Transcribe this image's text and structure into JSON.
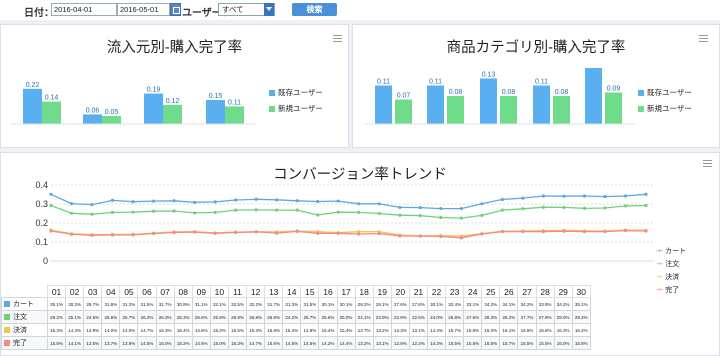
{
  "toolbar": {
    "date_label": "日付：",
    "date_from": "2016-04-01",
    "date_to": "2016-05-01",
    "user_label": "ユーザー：",
    "user_select_value": "すべて",
    "search_label": "検索"
  },
  "panel1": {
    "title": "流入元別-購入完了率",
    "legend": [
      "既存ユーザー",
      "新規ユーザー"
    ]
  },
  "panel2": {
    "title": "商品カテゴリ別-購入完了率",
    "legend": [
      "既存ユーザー",
      "新規ユーザー"
    ]
  },
  "panel3": {
    "title": "コンバージョン率トレンド",
    "legend": [
      "カート",
      "注文",
      "決済",
      "完了"
    ]
  },
  "colors": {
    "existing": "#5aaff0",
    "new": "#6fdc8c",
    "cart": "#5ba8e6",
    "order": "#6fd27a",
    "payment": "#f6c155",
    "complete": "#f28a86"
  },
  "chart_data": [
    {
      "type": "bar",
      "title": "流入元別-購入完了率",
      "categories": [
        "",
        "",
        "",
        ""
      ],
      "series": [
        {
          "name": "既存ユーザー",
          "values": [
            0.22,
            0.06,
            0.19,
            0.15
          ]
        },
        {
          "name": "新規ユーザー",
          "values": [
            0.14,
            0.05,
            0.12,
            0.11
          ]
        }
      ],
      "value_labels": [
        [
          "0.22",
          "0.06",
          "0.19",
          "0.15"
        ],
        [
          "0.14",
          "0.05",
          "0.12",
          "0.11"
        ]
      ],
      "legend_position": "right"
    },
    {
      "type": "bar",
      "title": "商品カテゴリ別-購入完了率",
      "categories": [
        "",
        "",
        "",
        "",
        ""
      ],
      "series": [
        {
          "name": "既存ユーザー",
          "values": [
            0.11,
            0.11,
            0.13,
            0.11,
            0.16
          ]
        },
        {
          "name": "新規ユーザー",
          "values": [
            0.07,
            0.08,
            0.08,
            0.08,
            0.09
          ]
        }
      ],
      "value_labels": [
        [
          "0.11",
          "0.11",
          "0.13",
          "0.11",
          ""
        ],
        [
          "0.07",
          "0.08",
          "0.08",
          "0.08",
          "0.09"
        ]
      ],
      "legend_position": "right"
    },
    {
      "type": "line",
      "title": "コンバージョン率トレンド",
      "x": [
        "01",
        "02",
        "03",
        "04",
        "05",
        "06",
        "07",
        "08",
        "09",
        "10",
        "11",
        "12",
        "13",
        "14",
        "15",
        "16",
        "17",
        "18",
        "19",
        "20",
        "21",
        "22",
        "23",
        "24",
        "25",
        "26",
        "27",
        "28",
        "29",
        "30"
      ],
      "yticks": [
        "0.4",
        "0.3",
        "0.2",
        "0.1",
        "0"
      ],
      "ylim": [
        0,
        0.4
      ],
      "grid": true,
      "legend_position": "right",
      "series": [
        {
          "name": "カート",
          "values": [
            0.351,
            0.302,
            0.297,
            0.319,
            0.312,
            0.315,
            0.317,
            0.309,
            0.311,
            0.321,
            0.325,
            0.322,
            0.317,
            0.313,
            0.315,
            0.301,
            0.301,
            0.282,
            0.281,
            0.276,
            0.276,
            0.301,
            0.324,
            0.331,
            0.342,
            0.341,
            0.342,
            0.339,
            0.342,
            0.351
          ],
          "labels": [
            "35.1%",
            "30.2%",
            "29.7%",
            "31.9%",
            "31.2%",
            "31.5%",
            "31.7%",
            "30.9%",
            "31.1%",
            "32.1%",
            "32.5%",
            "32.2%",
            "31.7%",
            "31.3%",
            "31.5%",
            "30.1%",
            "30.1%",
            "28.2%",
            "28.1%",
            "27.6%",
            "27.6%",
            "30.1%",
            "32.4%",
            "33.1%",
            "34.2%",
            "34.1%",
            "34.2%",
            "33.9%",
            "34.2%",
            "35.1%"
          ]
        },
        {
          "name": "注文",
          "values": [
            0.292,
            0.251,
            0.246,
            0.256,
            0.257,
            0.262,
            0.263,
            0.253,
            0.256,
            0.268,
            0.269,
            0.268,
            0.268,
            0.242,
            0.257,
            0.256,
            0.25,
            0.241,
            0.239,
            0.229,
            0.226,
            0.24,
            0.268,
            0.275,
            0.283,
            0.282,
            0.277,
            0.279,
            0.29,
            0.292
          ],
          "labels": [
            "29.2%",
            "25.1%",
            "24.6%",
            "25.6%",
            "25.7%",
            "26.2%",
            "26.3%",
            "25.3%",
            "25.6%",
            "26.8%",
            "26.9%",
            "26.8%",
            "26.8%",
            "24.2%",
            "25.7%",
            "25.6%",
            "25.0%",
            "24.1%",
            "23.9%",
            "22.9%",
            "22.6%",
            "24.0%",
            "26.8%",
            "27.5%",
            "28.3%",
            "28.2%",
            "27.7%",
            "27.9%",
            "29.0%",
            "29.2%"
          ]
        },
        {
          "name": "決済",
          "values": [
            0.163,
            0.143,
            0.139,
            0.14,
            0.14,
            0.147,
            0.153,
            0.154,
            0.148,
            0.152,
            0.155,
            0.153,
            0.158,
            0.154,
            0.149,
            0.154,
            0.154,
            0.137,
            0.132,
            0.133,
            0.131,
            0.144,
            0.157,
            0.158,
            0.16,
            0.161,
            0.159,
            0.158,
            0.163,
            0.162
          ],
          "labels": [
            "16.3%",
            "14.3%",
            "13.9%",
            "14.0%",
            "14.0%",
            "14.7%",
            "15.3%",
            "15.4%",
            "14.8%",
            "15.2%",
            "15.5%",
            "15.3%",
            "15.8%",
            "15.4%",
            "14.9%",
            "15.4%",
            "15.4%",
            "13.7%",
            "13.2%",
            "13.3%",
            "13.1%",
            "14.4%",
            "15.7%",
            "15.8%",
            "16.0%",
            "16.1%",
            "15.9%",
            "15.8%",
            "16.3%",
            "16.2%"
          ]
        },
        {
          "name": "完了",
          "values": [
            0.158,
            0.141,
            0.135,
            0.137,
            0.138,
            0.145,
            0.15,
            0.152,
            0.146,
            0.15,
            0.153,
            0.147,
            0.156,
            0.146,
            0.146,
            0.142,
            0.144,
            0.132,
            0.131,
            0.129,
            0.122,
            0.142,
            0.155,
            0.155,
            0.155,
            0.157,
            0.155,
            0.155,
            0.16,
            0.158
          ],
          "labels": [
            "15.8%",
            "14.1%",
            "13.5%",
            "13.7%",
            "13.8%",
            "14.5%",
            "15.0%",
            "15.2%",
            "14.6%",
            "15.0%",
            "15.3%",
            "14.7%",
            "15.6%",
            "14.6%",
            "14.6%",
            "14.2%",
            "14.4%",
            "13.2%",
            "13.1%",
            "12.9%",
            "12.2%",
            "14.2%",
            "15.5%",
            "15.5%",
            "15.5%",
            "15.7%",
            "15.5%",
            "15.5%",
            "16.0%",
            "15.8%"
          ]
        }
      ]
    }
  ]
}
